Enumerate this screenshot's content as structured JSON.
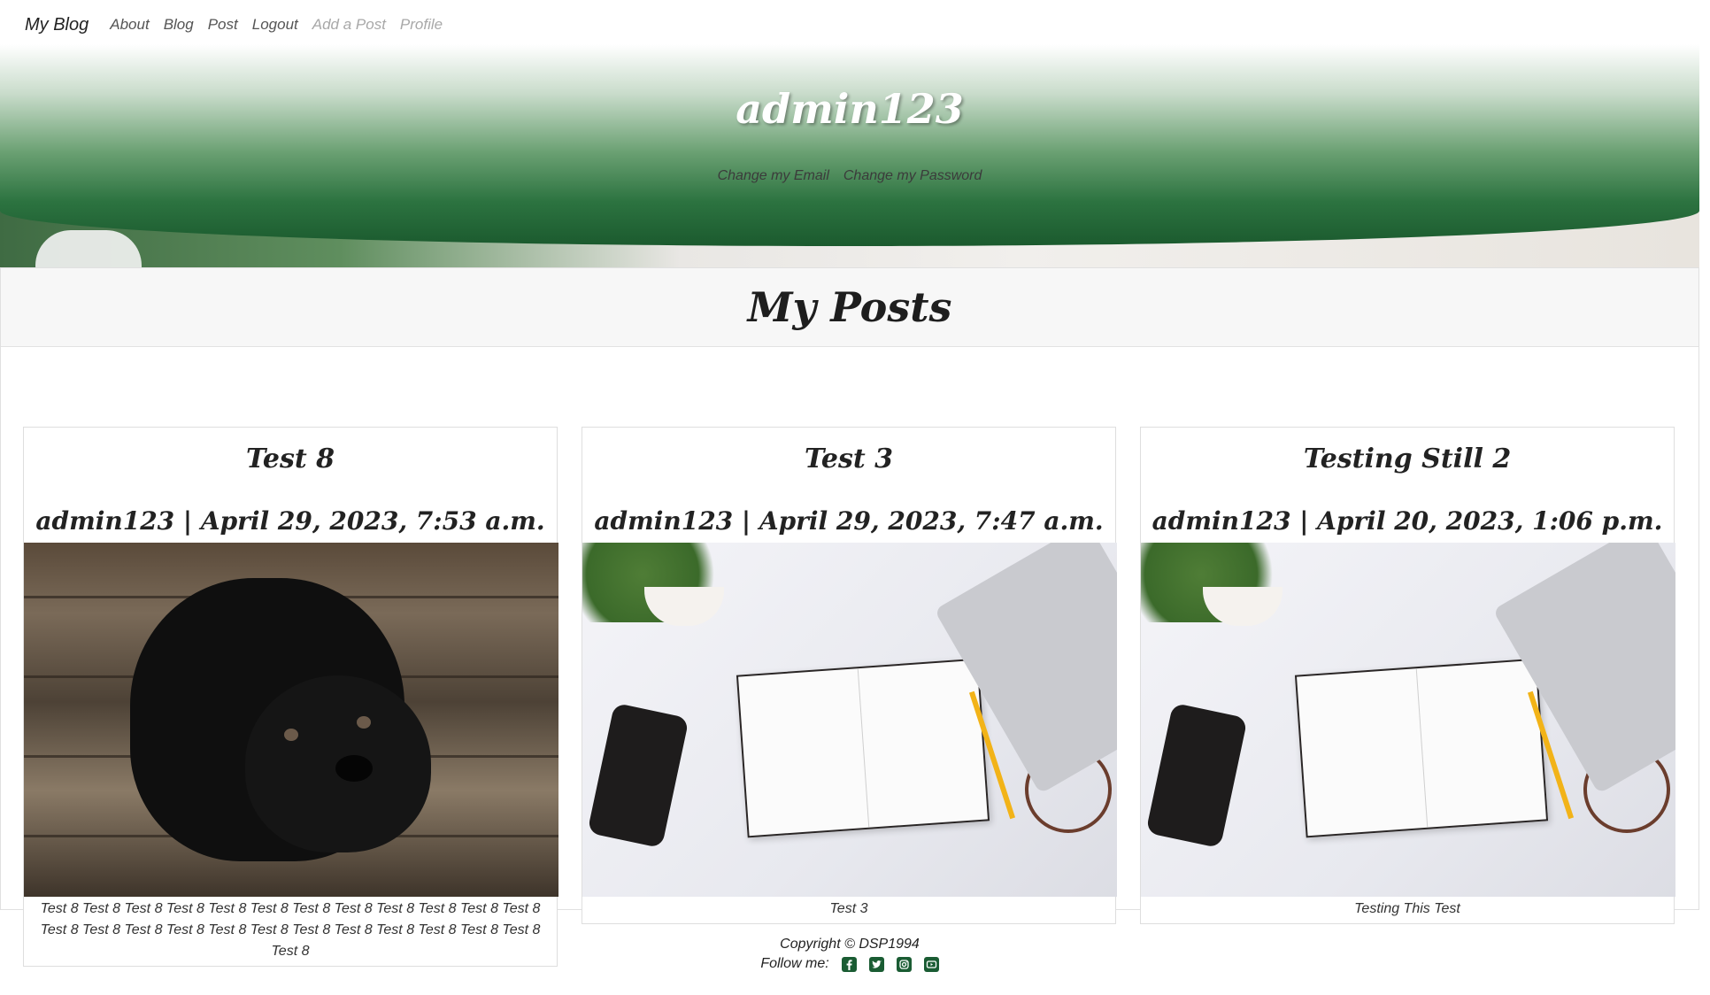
{
  "navbar": {
    "brand": "My Blog",
    "links": [
      "About",
      "Blog",
      "Post",
      "Logout"
    ],
    "muted_links": [
      "Add a Post",
      "Profile"
    ]
  },
  "profile": {
    "username": "admin123",
    "links": [
      "Change my Email",
      "Change my Password"
    ]
  },
  "section_title": "My Posts",
  "posts": [
    {
      "title": "Test 8",
      "meta": "admin123 | April 29, 2023, 7:53 a.m.",
      "image": "black-puppy-photo",
      "body": "Test 8 Test 8 Test 8 Test 8 Test 8 Test 8 Test 8 Test 8 Test 8 Test 8 Test 8 Test 8 Test 8 Test 8 Test 8 Test 8 Test 8 Test 8 Test 8 Test 8 Test 8 Test 8 Test 8 Test 8 Test 8"
    },
    {
      "title": "Test 3",
      "meta": "admin123 | April 29, 2023, 7:47 a.m.",
      "image": "desk-notebook-photo",
      "body": "Test 3"
    },
    {
      "title": "Testing Still 2",
      "meta": "admin123 | April 20, 2023, 1:06 p.m.",
      "image": "desk-notebook-photo",
      "body": "Testing This Test"
    }
  ],
  "footer": {
    "copyright": "Copyright © DSP1994",
    "follow_label": "Follow me:",
    "social_icons": [
      "facebook-icon",
      "twitter-icon",
      "instagram-icon",
      "youtube-icon"
    ]
  },
  "colors": {
    "brand_green": "#1b5a2e",
    "social_green": "#1a5c33"
  }
}
